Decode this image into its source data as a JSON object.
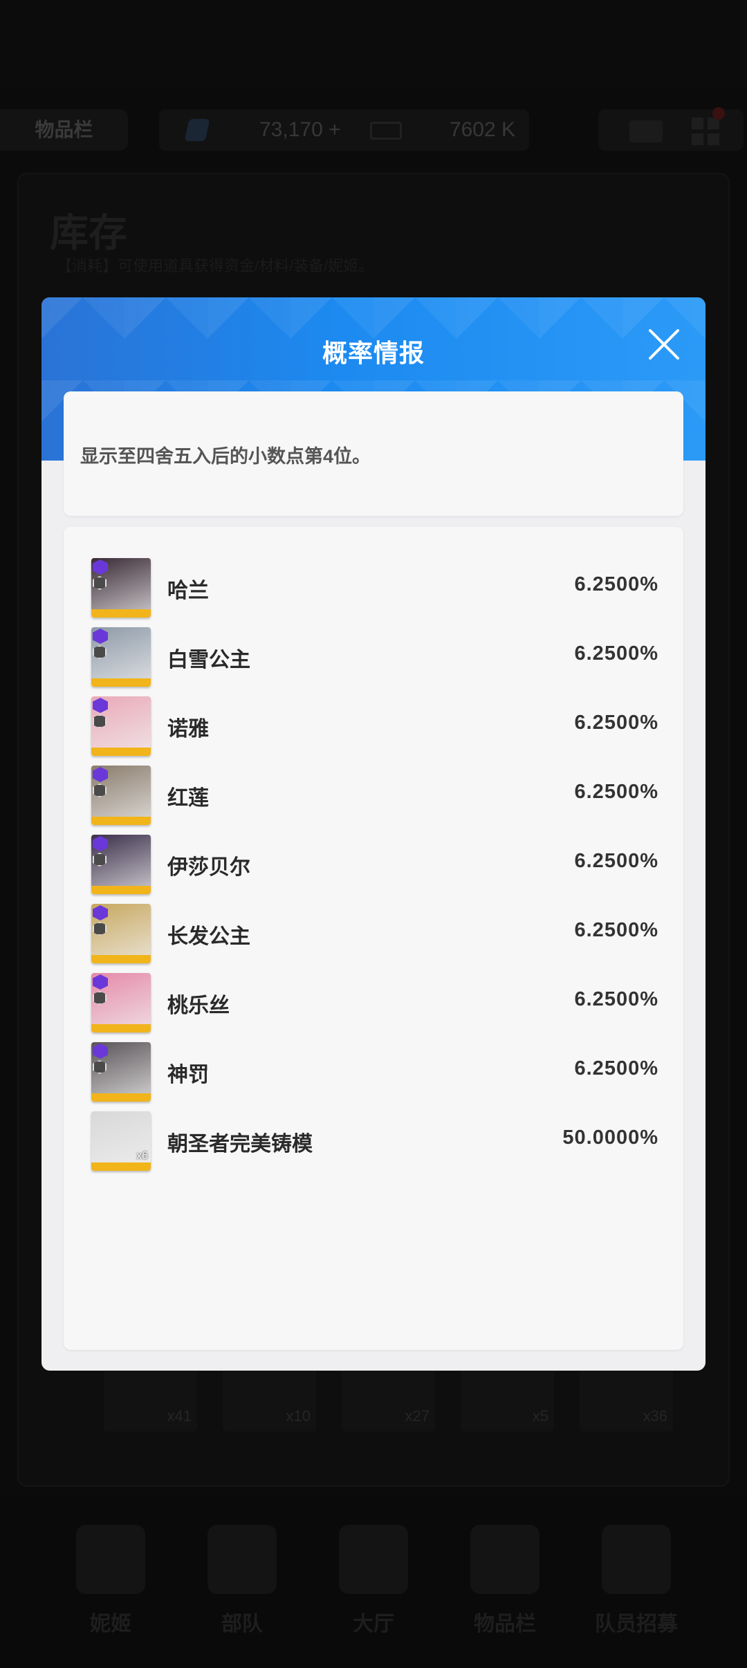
{
  "background": {
    "tab_label": "物品栏",
    "currency_1": "73,170 +",
    "currency_2": "7602 K",
    "panel_title": "库存",
    "panel_subtitle": "【消耗】可使用道具获得资金/材料/装备/妮姬。",
    "item_counts": [
      "x41",
      "x10",
      "x27",
      "x5",
      "x36"
    ],
    "nav": [
      "妮姬",
      "部队",
      "大厅",
      "物品栏",
      "队员招募"
    ]
  },
  "modal": {
    "title": "概率情报",
    "notice": "显示至四舍五入后的小数点第4位。",
    "items": [
      {
        "name": "哈兰",
        "rate": "6.2500%",
        "art": "#3a2a35"
      },
      {
        "name": "白雪公主",
        "rate": "6.2500%",
        "art": "#8e9aa8"
      },
      {
        "name": "诺雅",
        "rate": "6.2500%",
        "art": "#e9a9b8"
      },
      {
        "name": "红莲",
        "rate": "6.2500%",
        "art": "#8a7c6c"
      },
      {
        "name": "伊莎贝尔",
        "rate": "6.2500%",
        "art": "#3b2f4a"
      },
      {
        "name": "长发公主",
        "rate": "6.2500%",
        "art": "#c8a860"
      },
      {
        "name": "桃乐丝",
        "rate": "6.2500%",
        "art": "#e58aa8"
      },
      {
        "name": "神罚",
        "rate": "6.2500%",
        "art": "#5a5458"
      },
      {
        "name": "朝圣者完美铸模",
        "rate": "50.0000%",
        "art": "#d8d8d8",
        "qty": "x6",
        "material": true
      }
    ]
  },
  "colors": {
    "header_blue": "#1c8af0",
    "rarity_purple": "#6a38d8",
    "frame_gold": "#f1b41a"
  }
}
